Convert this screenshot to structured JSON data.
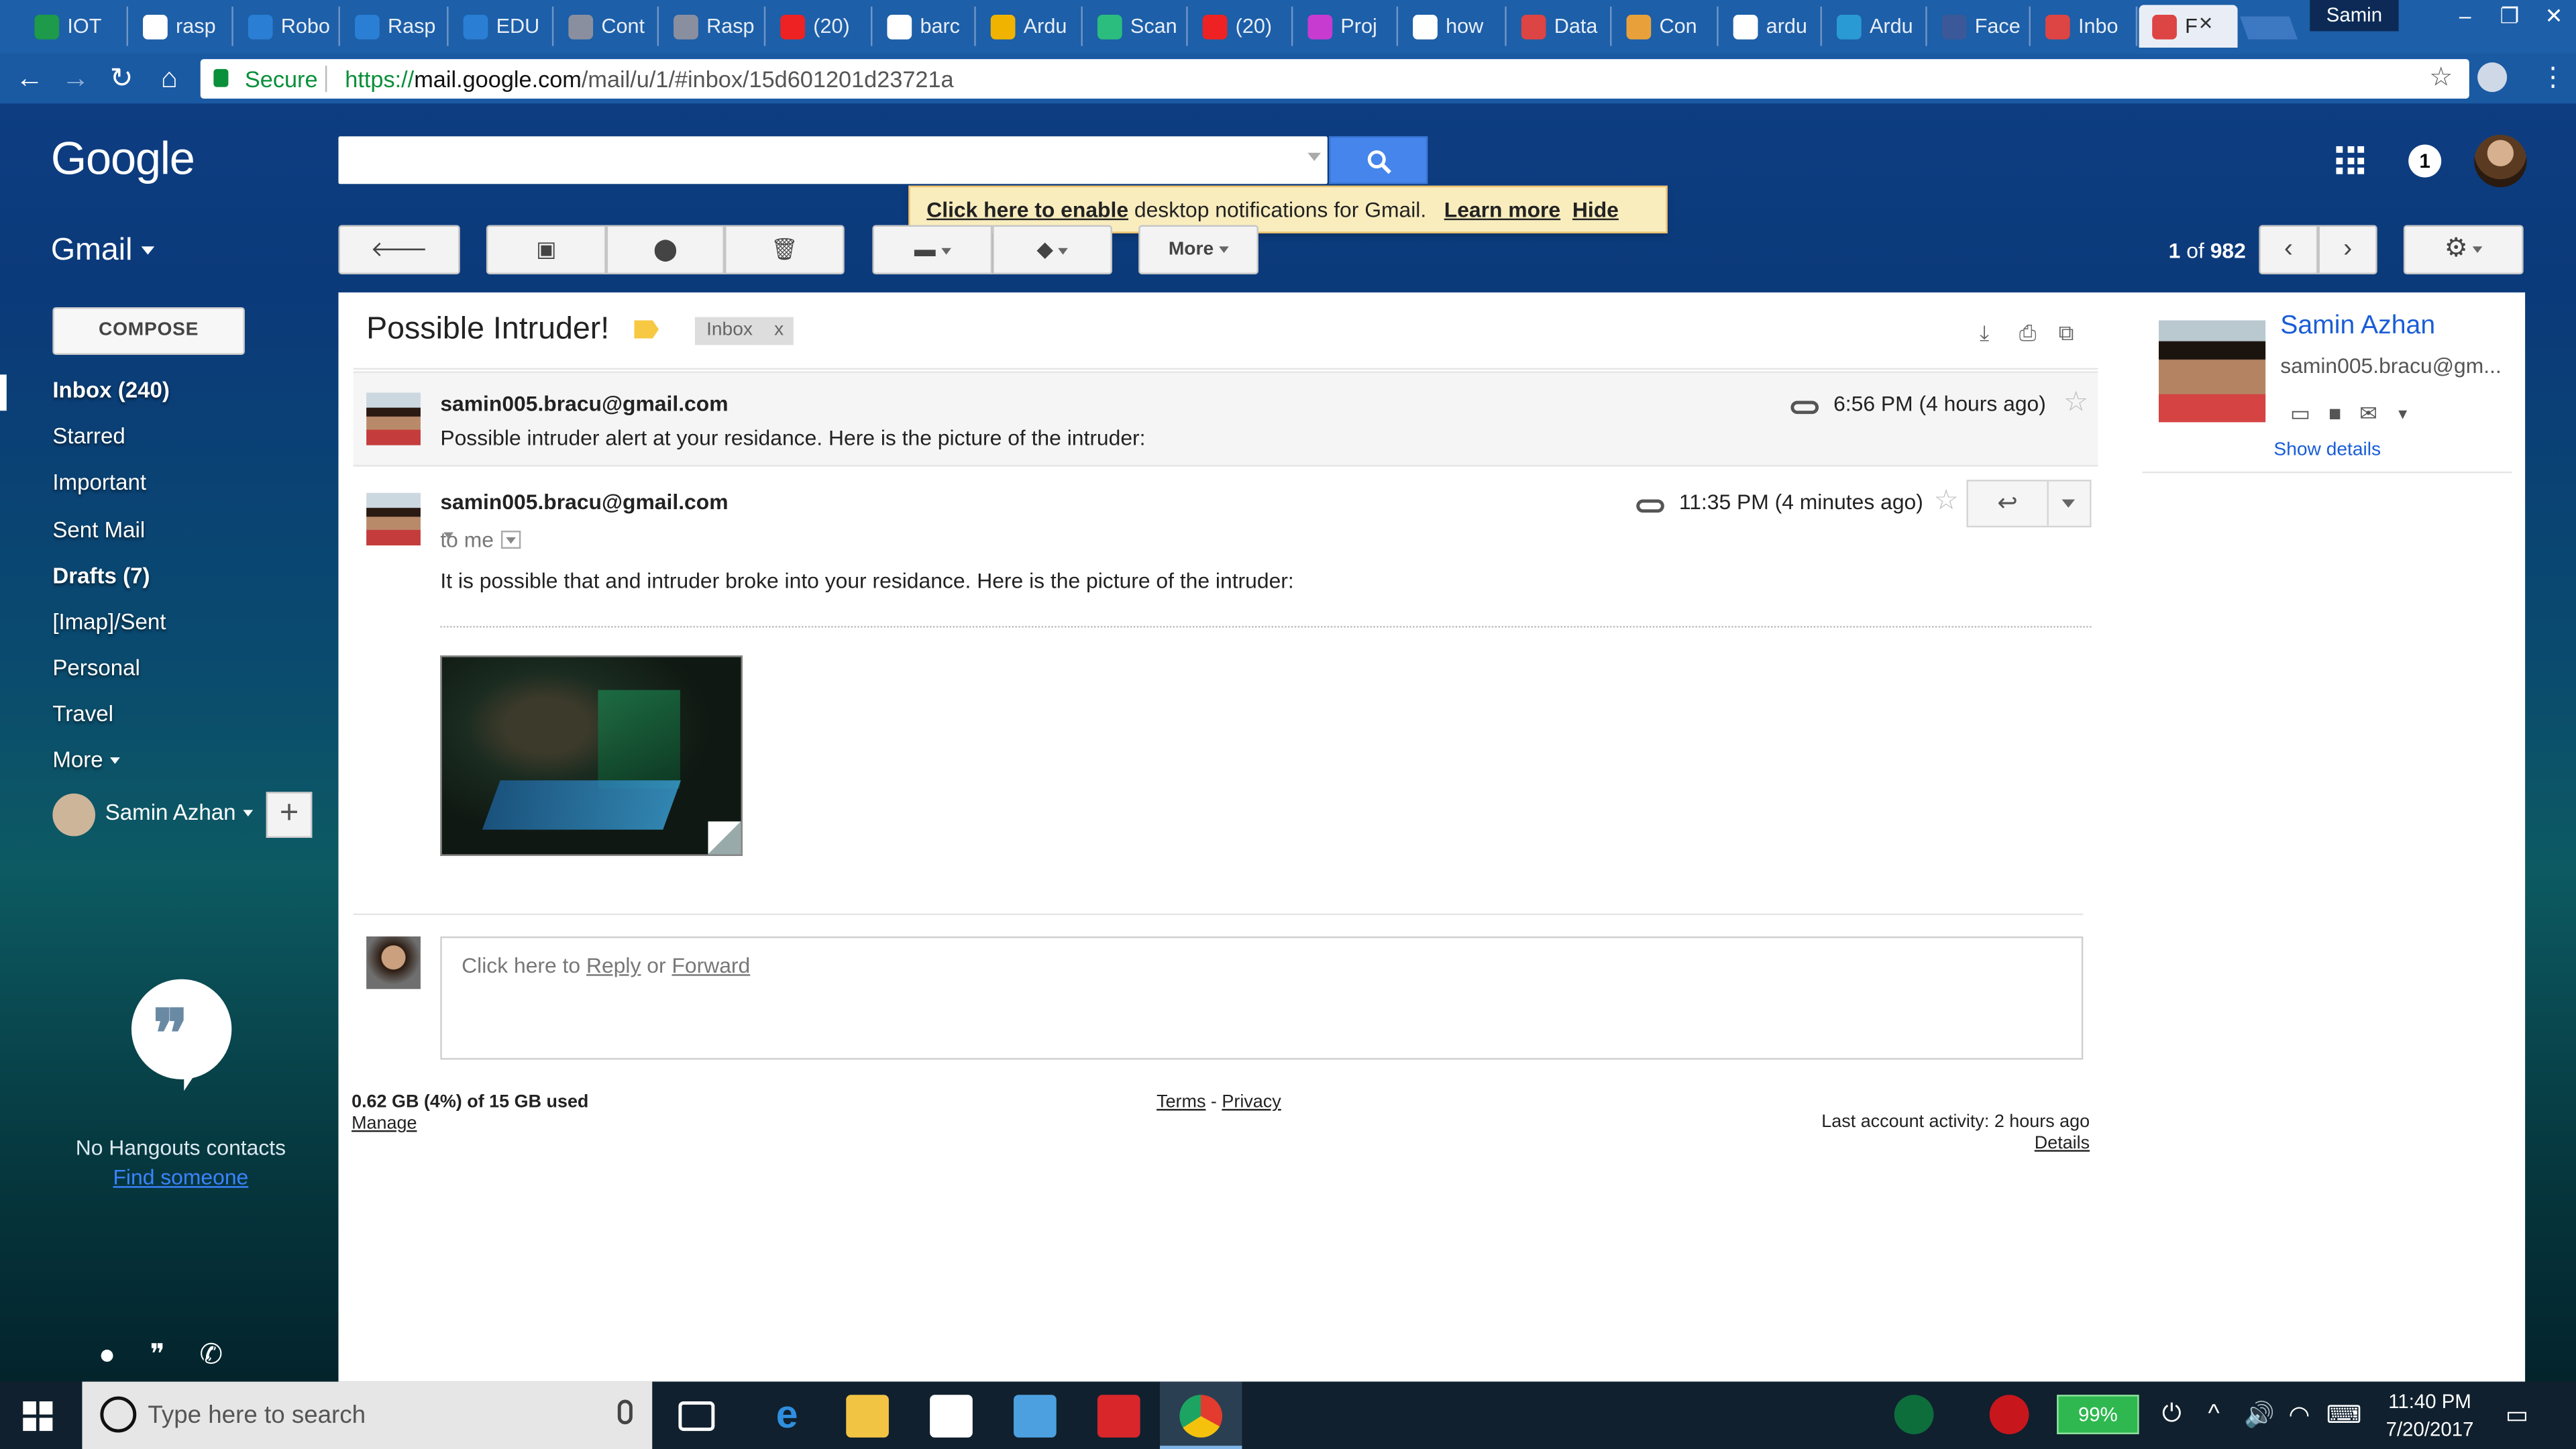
{
  "tabs": [
    {
      "label": "IOT"
    },
    {
      "label": "rasp"
    },
    {
      "label": "Robo"
    },
    {
      "label": "Rasp"
    },
    {
      "label": "EDU"
    },
    {
      "label": "Cont"
    },
    {
      "label": "Rasp"
    },
    {
      "label": "(20)"
    },
    {
      "label": "barc"
    },
    {
      "label": "Ardu"
    },
    {
      "label": "Scan"
    },
    {
      "label": "(20)"
    },
    {
      "label": "Proj"
    },
    {
      "label": "how"
    },
    {
      "label": "Data"
    },
    {
      "label": "Con"
    },
    {
      "label": "ardu"
    },
    {
      "label": "Ardu"
    },
    {
      "label": "Face"
    },
    {
      "label": "Inbo"
    },
    {
      "label": "F"
    }
  ],
  "window": {
    "user": "Samin",
    "min": "–",
    "max": "❐",
    "close": "✕"
  },
  "address": {
    "secure": "Secure",
    "url_scheme": "https://",
    "url_host": "mail.google.com",
    "url_path": "/mail/u/1/#inbox/15d601201d23721a"
  },
  "header": {
    "logo": "Google",
    "notifications": "1"
  },
  "toast": {
    "enable": "Click here to enable",
    "text": " desktop notifications for Gmail.",
    "learn": "Learn more",
    "hide": "Hide"
  },
  "gmail": {
    "label": "Gmail",
    "more": "More",
    "count_current": "1",
    "count_of": "of",
    "count_total": "982"
  },
  "sidebar": {
    "compose": "COMPOSE",
    "items": [
      {
        "label": "Inbox (240)"
      },
      {
        "label": "Starred"
      },
      {
        "label": "Important"
      },
      {
        "label": "Sent Mail"
      },
      {
        "label": "Drafts (7)"
      },
      {
        "label": "[Imap]/Sent"
      },
      {
        "label": "Personal"
      },
      {
        "label": "Travel"
      },
      {
        "label": "More"
      }
    ],
    "user": "Samin Azhan",
    "plus": "+",
    "no_hangouts": "No Hangouts contacts",
    "find_someone": "Find someone"
  },
  "thread": {
    "subject": "Possible Intruder!",
    "label_chip": "Inbox",
    "chip_x": "x",
    "messages": [
      {
        "sender": "samin005.bracu@gmail.com",
        "time": "6:56 PM (4 hours ago)",
        "snippet": "Possible intruder alert at your residance. Here is the picture of the intruder:"
      },
      {
        "sender": "samin005.bracu@gmail.com",
        "time": "11:35 PM (4 minutes ago)",
        "to": "to me",
        "body": "It is possible that and intruder broke into your residance. Here is the picture of the intruder:"
      }
    ],
    "reply_prefix": "Click here to ",
    "reply": "Reply",
    "or": " or ",
    "forward": "Forward"
  },
  "footer": {
    "storage": "0.62 GB (4%) of 15 GB used",
    "manage": "Manage",
    "terms": "Terms",
    "dash": " - ",
    "privacy": "Privacy",
    "activity": "Last account activity: 2 hours ago",
    "details": "Details"
  },
  "contact": {
    "name": "Samin Azhan",
    "email": "samin005.bracu@gm...",
    "show_details": "Show details"
  },
  "taskbar": {
    "search_placeholder": "Type here to search",
    "battery": "99%",
    "time": "11:40 PM",
    "date": "7/20/2017"
  }
}
